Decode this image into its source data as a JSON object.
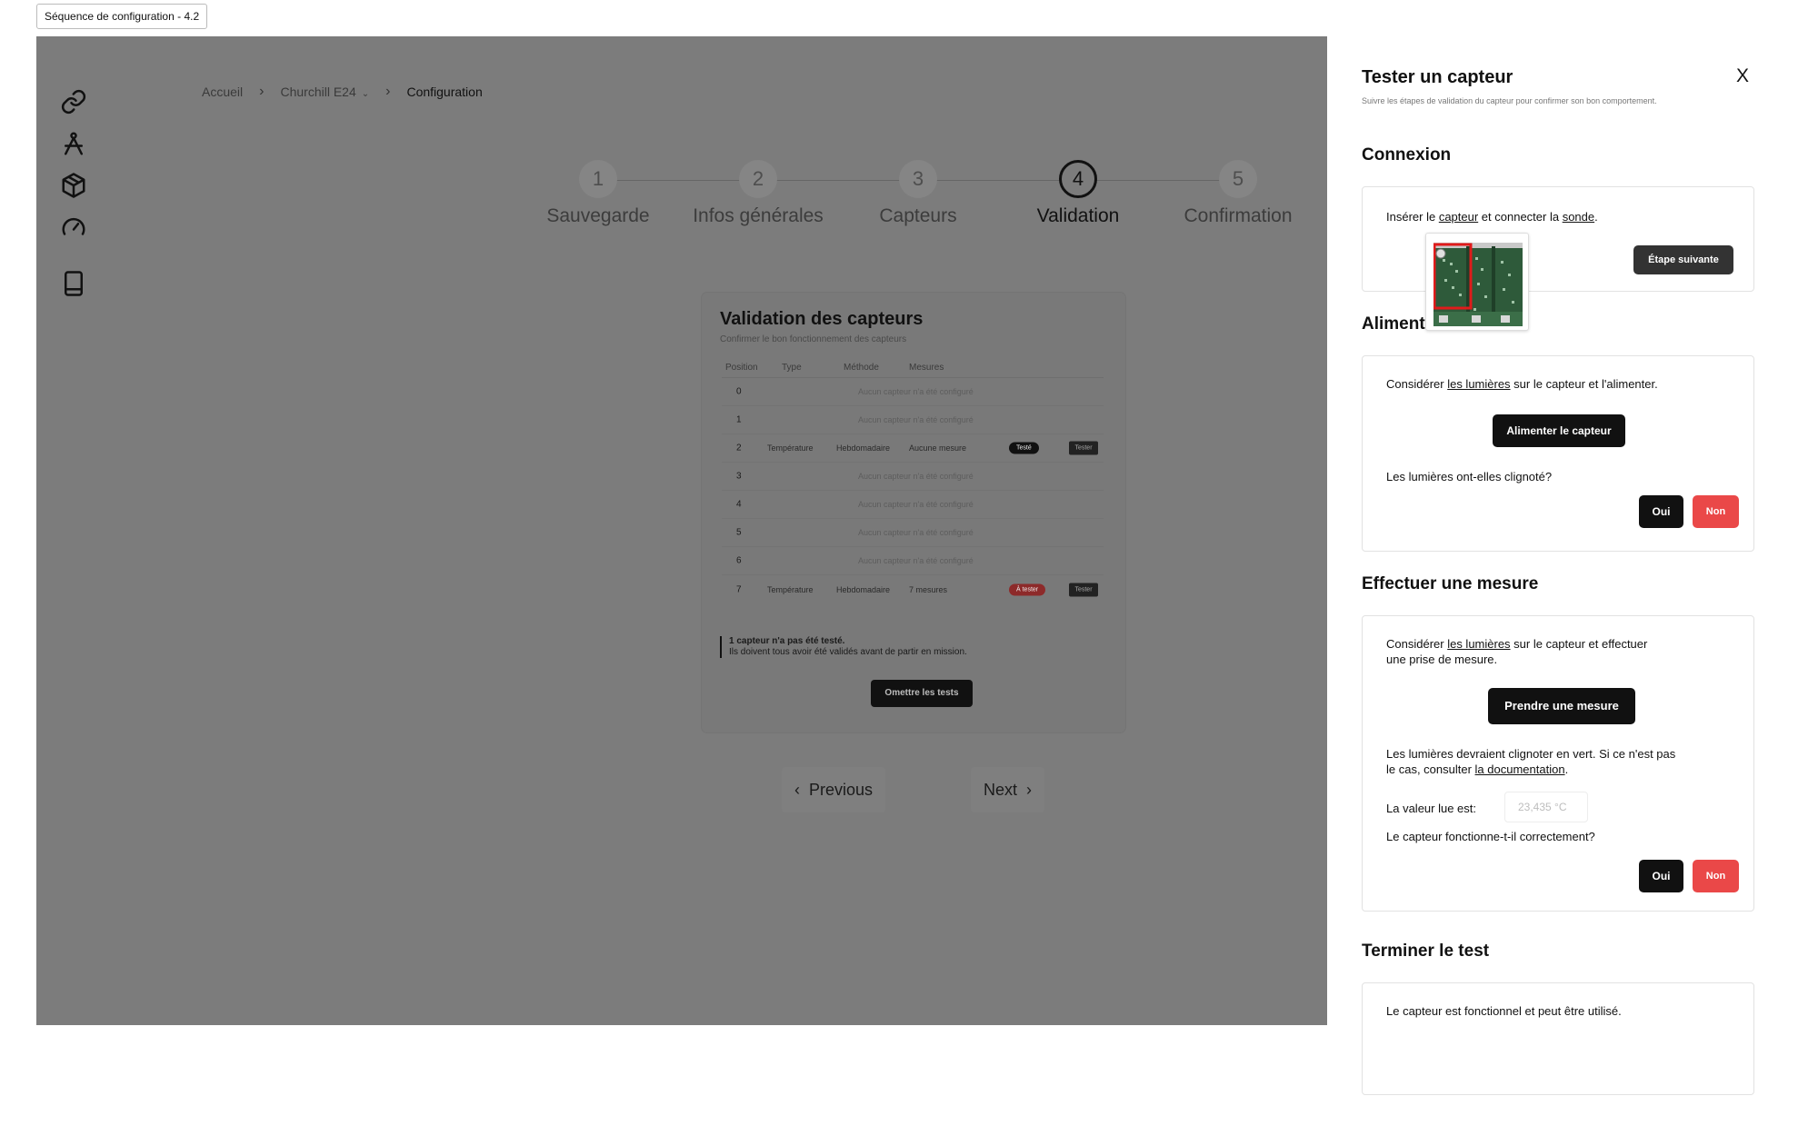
{
  "frame_tag": "Séquence de configuration - 4.2",
  "sidebar": {
    "icons": [
      "link-icon",
      "compass-icon",
      "package-icon",
      "gauge-icon",
      "book-icon"
    ]
  },
  "breadcrumb": {
    "home": "Accueil",
    "project": "Churchill E24",
    "current": "Configuration"
  },
  "stepper": {
    "steps": [
      {
        "number": "1",
        "label": "Sauvegarde"
      },
      {
        "number": "2",
        "label": "Infos générales"
      },
      {
        "number": "3",
        "label": "Capteurs"
      },
      {
        "number": "4",
        "label": "Validation"
      },
      {
        "number": "5",
        "label": "Confirmation"
      }
    ],
    "active_step": 4
  },
  "validation_card": {
    "title": "Validation des capteurs",
    "subtitle": "Confirmer le bon fonctionnement des capteurs",
    "columns": [
      "Position",
      "Type",
      "Méthode",
      "Mesures"
    ],
    "rows": [
      {
        "position": "0",
        "empty": "Aucun capteur n'a été configuré"
      },
      {
        "position": "1",
        "empty": "Aucun capteur n'a été configuré"
      },
      {
        "position": "2",
        "type": "Température",
        "method": "Hebdomadaire",
        "measures": "Aucune mesure",
        "badge": "Testé",
        "action": "Tester"
      },
      {
        "position": "3",
        "empty": "Aucun capteur n'a été configuré"
      },
      {
        "position": "4",
        "empty": "Aucun capteur n'a été configuré"
      },
      {
        "position": "5",
        "empty": "Aucun capteur n'a été configuré"
      },
      {
        "position": "6",
        "empty": "Aucun capteur n'a été configuré"
      },
      {
        "position": "7",
        "type": "Température",
        "method": "Hebdomadaire",
        "measures": "7 mesures",
        "badge": "À tester",
        "action": "Tester"
      }
    ],
    "warning_title": "1 capteur n'a pas été testé.",
    "warning_text": "Ils doivent tous avoir été validés avant de partir en mission.",
    "skip_button": "Omettre les tests"
  },
  "nav": {
    "previous": "Previous",
    "next": "Next"
  },
  "panel": {
    "title": "Tester un capteur",
    "close": "X",
    "subtitle": "Suivre les étapes de validation du capteur pour confirmer son bon comportement.",
    "connexion": {
      "heading": "Connexion",
      "text_before": "Insérer le ",
      "link1": "capteur",
      "text_mid": " et connecter la ",
      "link2": "sonde",
      "text_after": ".",
      "next_button": "Étape suivante"
    },
    "alimentation": {
      "heading": "Alimentation",
      "text_before": "Considérer ",
      "link": "les lumières",
      "text_after": " sur le capteur et l'alimenter.",
      "power_button": "Alimenter le capteur",
      "question": "Les lumières ont-elles clignoté?",
      "yes": "Oui",
      "no": "Non"
    },
    "mesure": {
      "heading": "Effectuer une mesure",
      "text_before": "Considérer ",
      "link": "les lumières",
      "text_after": " sur le capteur et effectuer",
      "text_line2": "une prise de mesure.",
      "measure_button": "Prendre une mesure",
      "info_line1": "Les lumières devraient clignoter en vert. Si ce n'est pas",
      "info_line2_before": "le cas, consulter ",
      "info_link": "la documentation",
      "info_line2_after": ".",
      "value_label": "La valeur lue est:",
      "value_placeholder": "23,435 °C",
      "question": "Le capteur fonctionne-t-il correctement?",
      "yes": "Oui",
      "no": "Non"
    },
    "terminer": {
      "heading": "Terminer le test",
      "text": "Le capteur est fonctionnel et peut être utilisé."
    }
  },
  "colors": {
    "overlay": "#7c7c7c",
    "danger": "#ea4848",
    "dark": "#111111"
  }
}
